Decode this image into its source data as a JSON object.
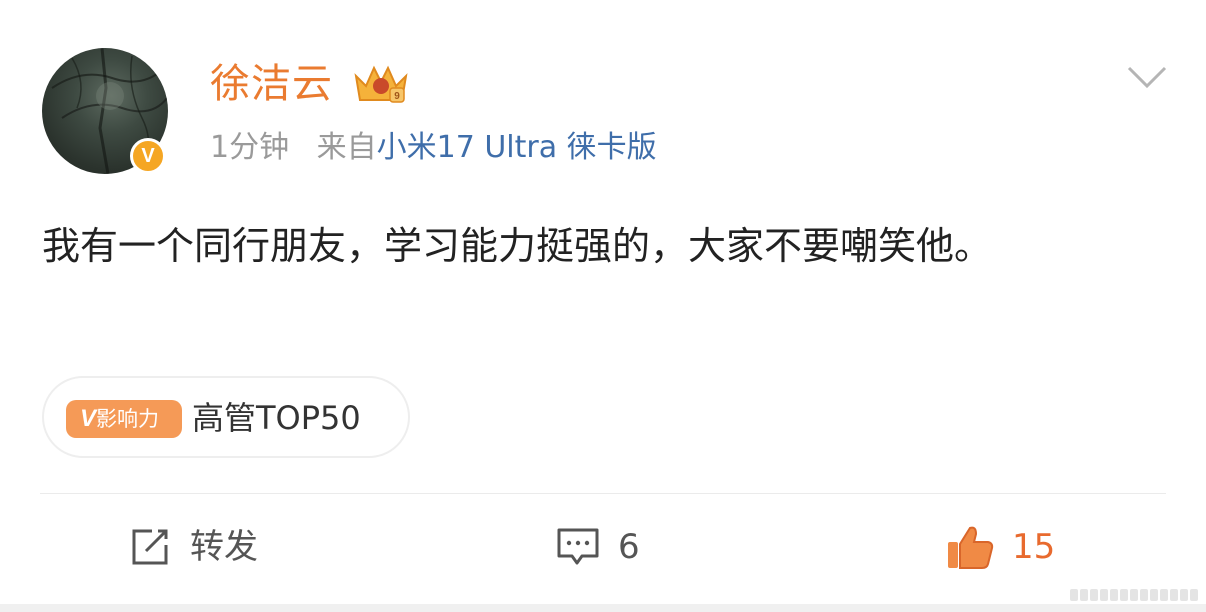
{
  "post": {
    "author": "徐洁云",
    "verified_mark": "V",
    "time": "1分钟",
    "source_prefix": "来自",
    "device": "小米17 Ultra 徕卡版",
    "text": "我有一个同行朋友，学习能力挺强的，大家不要嘲笑他。"
  },
  "tag": {
    "badge_v": "V",
    "badge_label": "影响力",
    "text": "高管TOP50"
  },
  "actions": {
    "repost_label": "转发",
    "comment_count": "6",
    "like_count": "15"
  },
  "colors": {
    "username": "#ea7b30",
    "device_link": "#3f6eaa",
    "verified_badge": "#f5a623",
    "tag_badge": "#f59a57",
    "like_active": "#e86a2e"
  },
  "icons": {
    "crown": "crown-member-icon",
    "more": "chevron-down-icon",
    "repost": "repost-icon",
    "comment": "comment-icon",
    "like": "thumbs-up-icon"
  }
}
